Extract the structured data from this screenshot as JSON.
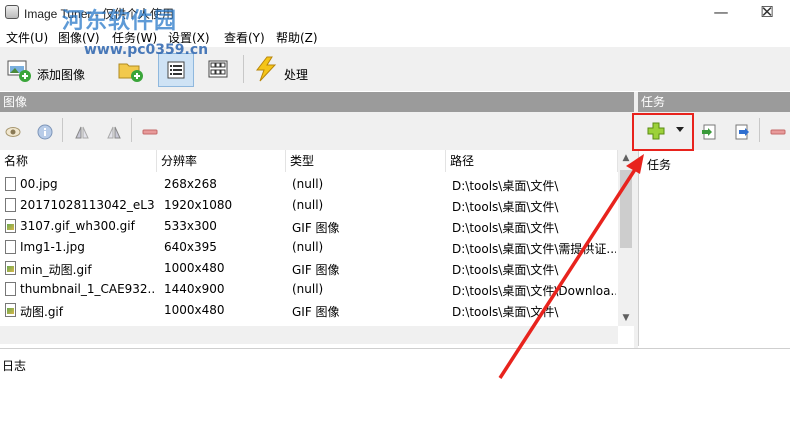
{
  "window": {
    "title": "Image Tuner - 仅供个人使用",
    "watermark_text": "河东软件园",
    "watermark_url": "www.pc0359.cn",
    "minimize_glyph": "—",
    "maximize_glyph": "☐",
    "close_glyph": "✕"
  },
  "menu": [
    {
      "label": "文件(U)"
    },
    {
      "label": "图像(V)"
    },
    {
      "label": "任务(W)"
    },
    {
      "label": "设置(X)"
    },
    {
      "label": "查看(Y)"
    },
    {
      "label": "帮助(Z)"
    }
  ],
  "toolbar": {
    "add_image_label": "添加图像",
    "process_label": "处理",
    "icons": [
      "add-image-icon",
      "add-folder-icon",
      "list-view-icon",
      "thumbnail-view-icon",
      "process-lightning-icon"
    ]
  },
  "images_pane": {
    "title": "图像",
    "tool_icons": [
      "preview-eye-icon",
      "info-icon",
      "flip-icon",
      "mirror-icon",
      "remove-icon"
    ]
  },
  "tasks_pane": {
    "title": "任务",
    "column_header": "任务",
    "tool_icons": [
      "add-task-plus-icon",
      "dropdown-arrow-icon",
      "import-task-icon",
      "export-task-icon",
      "remove-task-icon"
    ]
  },
  "table": {
    "columns": [
      "名称",
      "分辨率",
      "类型",
      "路径"
    ],
    "rows": [
      {
        "name": "00.jpg",
        "resolution": "268x268",
        "type": "(null)",
        "path": "D:\\tools\\桌面\\文件\\",
        "icon": "blank"
      },
      {
        "name": "20171028113042_eL3...",
        "resolution": "1920x1080",
        "type": "(null)",
        "path": "D:\\tools\\桌面\\文件\\",
        "icon": "blank"
      },
      {
        "name": "3107.gif_wh300.gif",
        "resolution": "533x300",
        "type": "GIF 图像",
        "path": "D:\\tools\\桌面\\文件\\",
        "icon": "img"
      },
      {
        "name": "Img1-1.jpg",
        "resolution": "640x395",
        "type": "(null)",
        "path": "D:\\tools\\桌面\\文件\\需提供证...",
        "icon": "blank"
      },
      {
        "name": "min_动图.gif",
        "resolution": "1000x480",
        "type": "GIF 图像",
        "path": "D:\\tools\\桌面\\文件\\",
        "icon": "img"
      },
      {
        "name": "thumbnail_1_CAE932...",
        "resolution": "1440x900",
        "type": "(null)",
        "path": "D:\\tools\\桌面\\文件\\Downloa...",
        "icon": "blank"
      },
      {
        "name": "动图.gif",
        "resolution": "1000x480",
        "type": "GIF 图像",
        "path": "D:\\tools\\桌面\\文件\\",
        "icon": "img"
      }
    ]
  },
  "log": {
    "title": "日志"
  },
  "colors": {
    "pane_header_bg": "#9b9b9b",
    "highlight_red": "#e8231d",
    "toolbar_bg": "#f0f0f0"
  }
}
